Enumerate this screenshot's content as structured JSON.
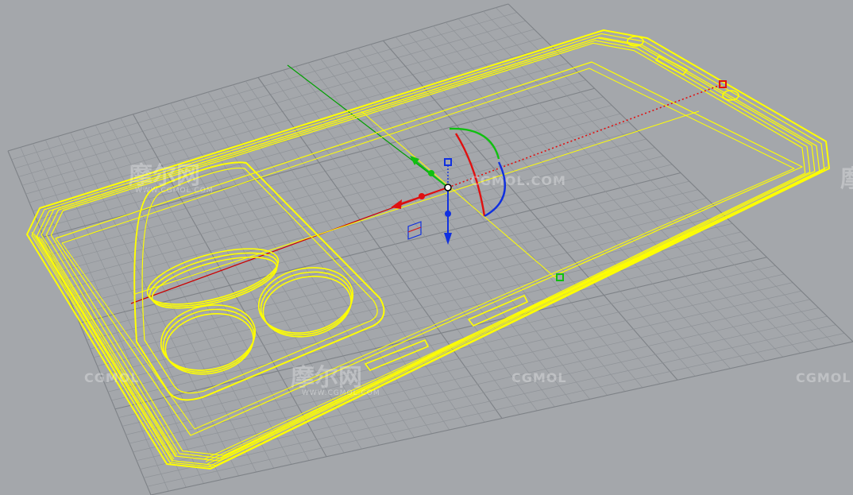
{
  "viewport": {
    "background_color": "#a4a7ab",
    "grid_color": "#8f9398",
    "grid_major_color": "#7e8287",
    "model_wire_color": "#ffff00",
    "axis_x_color": "#cc0000",
    "axis_y_color": "#00a000"
  },
  "gizmo": {
    "x_color": "#e01010",
    "y_color": "#10c010",
    "z_color": "#1030e0",
    "center_icon": "gumball-center-icon"
  },
  "watermarks": {
    "cgmol_left": "CGMOL",
    "cgmol_center": "CGMOL",
    "cgmol_right": "CGMOL",
    "cgmol_top": "CGMOL.COM",
    "cn_brand_left": "摩尔网",
    "cn_brand_center": "摩尔网",
    "cn_brand_right": "摩",
    "sub_left": "WWW.CGMOL.COM",
    "sub_center": "WWW.CGMOL.COM"
  }
}
